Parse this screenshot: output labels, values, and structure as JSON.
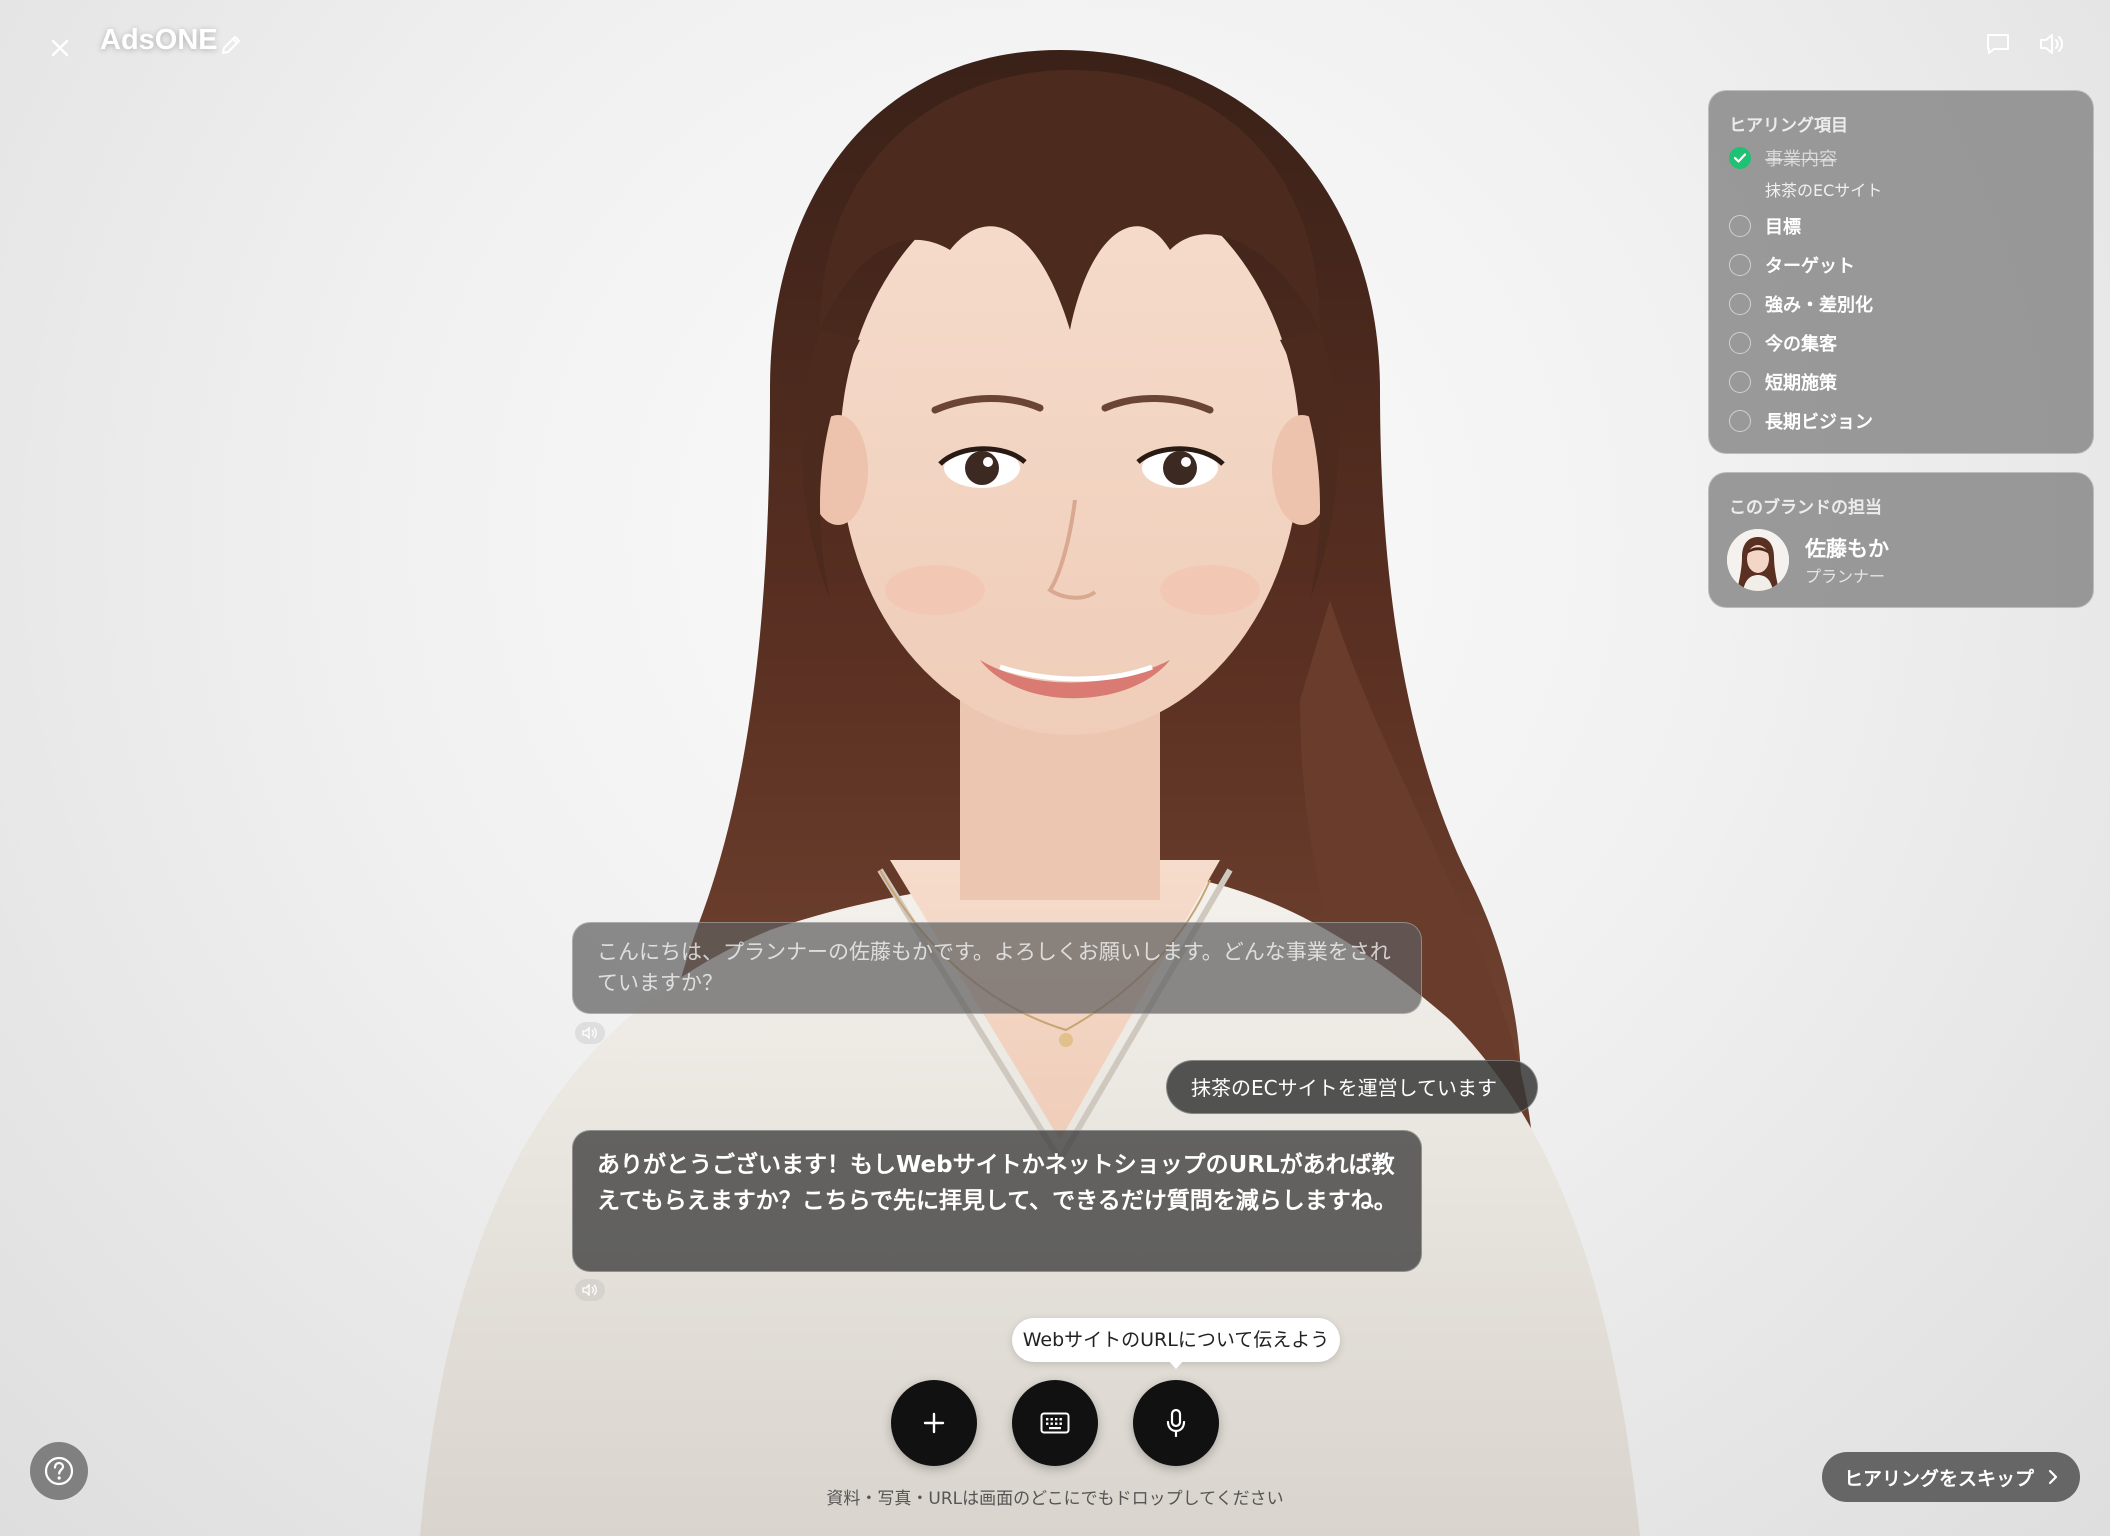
{
  "header": {
    "title": "AdsONE",
    "icons": [
      "close-icon",
      "pencil-icon",
      "chat-bubble-icon",
      "speaker-icon"
    ]
  },
  "hearing": {
    "title": "ヒアリング項目",
    "items": [
      {
        "label": "事業内容",
        "done": true,
        "answer": "抹茶のECサイト"
      },
      {
        "label": "目標",
        "done": false
      },
      {
        "label": "ターゲット",
        "done": false
      },
      {
        "label": "強み・差別化",
        "done": false
      },
      {
        "label": "今の集客",
        "done": false
      },
      {
        "label": "短期施策",
        "done": false
      },
      {
        "label": "長期ビジョン",
        "done": false
      }
    ],
    "check_color": "#1fc173"
  },
  "owner": {
    "title": "このブランドの担当",
    "name": "佐藤もか",
    "role": "プランナー"
  },
  "chat": {
    "messages": [
      {
        "role": "assistant",
        "text": "こんにちは、プランナーの佐藤もかです。よろしくお願いします。どんな事業をされていますか？"
      },
      {
        "role": "user",
        "text": "抹茶のECサイトを運営しています"
      },
      {
        "role": "assistant",
        "text": "ありがとうございます！もしWebサイトかネットショップのURLがあれば教えてもらえますか？こちらで先に拝見して、できるだけ質問を減らしますね。"
      }
    ]
  },
  "controls": {
    "hint": "WebサイトのURLについて伝えよう",
    "drop_hint": "資料・写真・URLは画面のどこにでもドロップしてください",
    "buttons": [
      "plus-icon",
      "keyboard-icon",
      "microphone-icon"
    ],
    "skip_label": "ヒアリングをスキップ"
  }
}
